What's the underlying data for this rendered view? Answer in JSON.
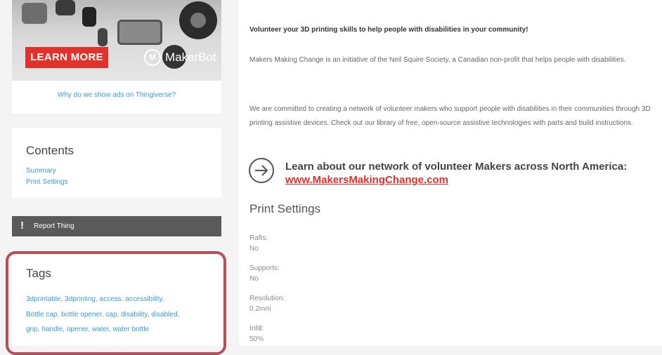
{
  "ad": {
    "cta_label": "LEARN MORE",
    "brand": "MakerBot",
    "brand_mark": "M",
    "why_link": "Why do we show ads on Thingiverse?"
  },
  "contents": {
    "title": "Contents",
    "links": [
      "Summary",
      "Print Settings"
    ]
  },
  "report": {
    "icon": "!",
    "label": "Report Thing"
  },
  "tags": {
    "title": "Tags",
    "lines": [
      "3dprintable, 3dprinting, access, accessibility,",
      "Bottle cap, bottle opener, cap, disability, disabled,",
      "grip, handle, opener, water, water bottle"
    ]
  },
  "summary": {
    "intro": "Volunteer your 3D printing skills to help people with disabilities in your community!",
    "para1": "Makers Making Change is an initiative of the Neil Squire Society, a Canadian non-profit that helps people with disabilities.",
    "para2": "We are committed to creating a network of volunteer makers who support people with disabilities in their communities through 3D printing assistive devices. Check out our library of free, open-source assistive technologies with parts and build instructions.",
    "cta_text": "Learn about our network of volunteer Makers across North America:",
    "cta_link": "www.MakersMakingChange.com"
  },
  "print_settings": {
    "title": "Print Settings",
    "items": [
      {
        "label": "Rafts:",
        "value": "No"
      },
      {
        "label": "Supports:",
        "value": "No"
      },
      {
        "label": "Resolution:",
        "value": "0.2mm"
      },
      {
        "label": "Infill:",
        "value": "50%"
      }
    ]
  }
}
